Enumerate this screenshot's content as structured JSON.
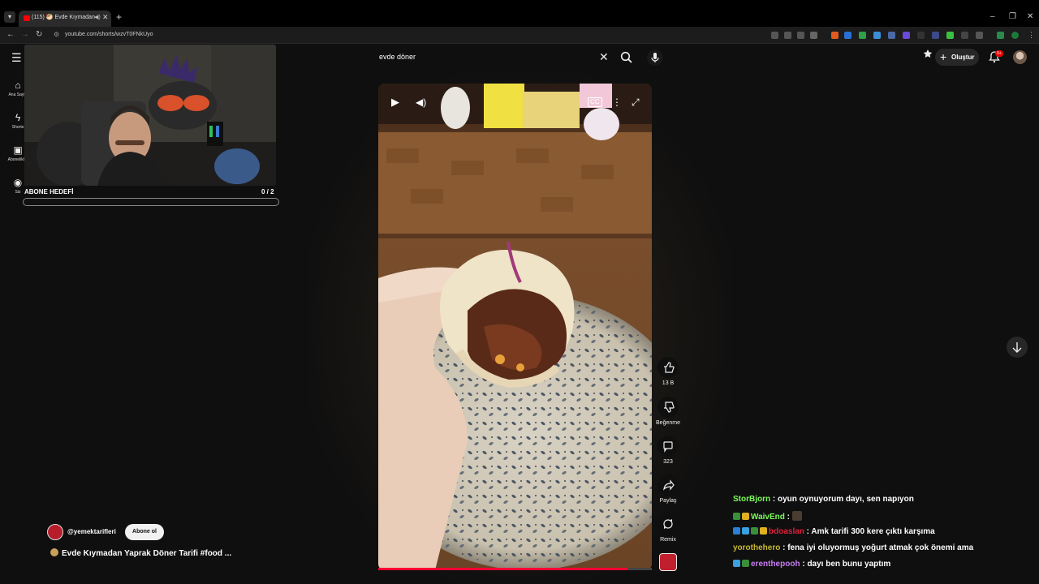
{
  "browser": {
    "tab_title": "(115) 🥙 Evde Kıymadan Ya...",
    "url": "youtube.com/shorts/wzvT0FNkUyo"
  },
  "sidebar": {
    "items": [
      {
        "label": "Ana Sayfa",
        "icon": "home-icon"
      },
      {
        "label": "Shorts",
        "icon": "shorts-icon"
      },
      {
        "label": "Abonelikler",
        "icon": "subscriptions-icon"
      },
      {
        "label": "Siz",
        "icon": "you-icon"
      }
    ]
  },
  "search": {
    "query": "evde döner"
  },
  "header": {
    "create_label": "Oluştur",
    "notification_badge": "9+"
  },
  "webcam": {
    "goal_label": "ABONE HEDEFİ",
    "goal_count": "0  / 2",
    "goal_progress": 0
  },
  "player": {
    "progress": 0.91
  },
  "actions": {
    "like_count": "13 B",
    "dislike_label": "Beğenme",
    "comment_count": "323",
    "share_label": "Paylaş",
    "remix_label": "Remix"
  },
  "channel": {
    "handle": "@yemektarifleri",
    "subscribe_label": "Abone ol",
    "video_title": "Evde Kıymadan Yaprak Döner Tarifi  #food ..."
  },
  "chat": [
    {
      "user": "StorBjorn",
      "color": "#7cfc5a",
      "message": " : oyun oynuyorum dayı, sen napıyon",
      "badges": []
    },
    {
      "user": "WaivEnd",
      "color": "#7cfc5a",
      "message": " : ",
      "badges": [
        "#3a8f3a",
        "#e0b020"
      ],
      "emote": true
    },
    {
      "user": "bdoaslan",
      "color": "#e0203a",
      "message": " : Amk tarifi 300 kere çıktı karşıma",
      "badges": [
        "#2a7fd6",
        "#3aa0e0",
        "#3a8f3a",
        "#e0b020"
      ]
    },
    {
      "user": "yorothehero",
      "color": "#c8b830",
      "message": " : fena iyi oluyormuş yoğurt atmak çok önemi ama",
      "badges": []
    },
    {
      "user": "erenthepooh",
      "color": "#c87cf0",
      "message": " : dayı ben bunu yaptım",
      "badges": [
        "#3aa0e0",
        "#3a8f3a"
      ]
    }
  ]
}
